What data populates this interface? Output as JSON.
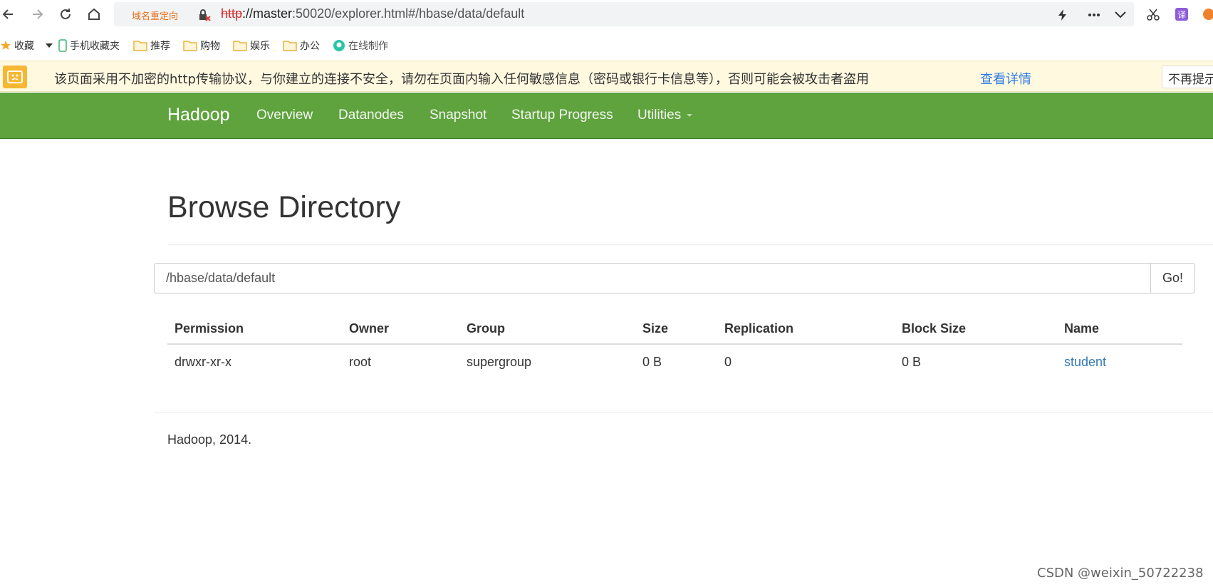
{
  "browser": {
    "redirect_tag": "域名重定向",
    "url": {
      "proto": "http",
      "host": "://master",
      "rest": ":50020/explorer.html#/hbase/data/default"
    },
    "bookmarks": [
      "收藏",
      "手机收藏夹",
      "推荐",
      "购物",
      "娱乐",
      "办公",
      "在线制作"
    ],
    "security_warning": {
      "text": "该页面采用不加密的http传输协议，与你建立的连接不安全，请勿在页面内输入任何敏感信息（密码或银行卡信息等），否则可能会被攻击者盗用",
      "details_link": "查看详情",
      "dismiss_button": "不再提示"
    }
  },
  "navbar": {
    "brand": "Hadoop",
    "items": [
      "Overview",
      "Datanodes",
      "Snapshot",
      "Startup Progress",
      "Utilities"
    ],
    "bg_color": "#5fa33e"
  },
  "page": {
    "title": "Browse Directory",
    "path_value": "/hbase/data/default",
    "go_button": "Go!"
  },
  "table": {
    "headers": [
      "Permission",
      "Owner",
      "Group",
      "Size",
      "Replication",
      "Block Size",
      "Name"
    ],
    "rows": [
      {
        "permission": "drwxr-xr-x",
        "owner": "root",
        "group": "supergroup",
        "size": "0 B",
        "replication": "0",
        "block_size": "0 B",
        "name": "student"
      }
    ]
  },
  "footer": {
    "text": "Hadoop, 2014."
  },
  "watermark": "CSDN @weixin_50722238"
}
